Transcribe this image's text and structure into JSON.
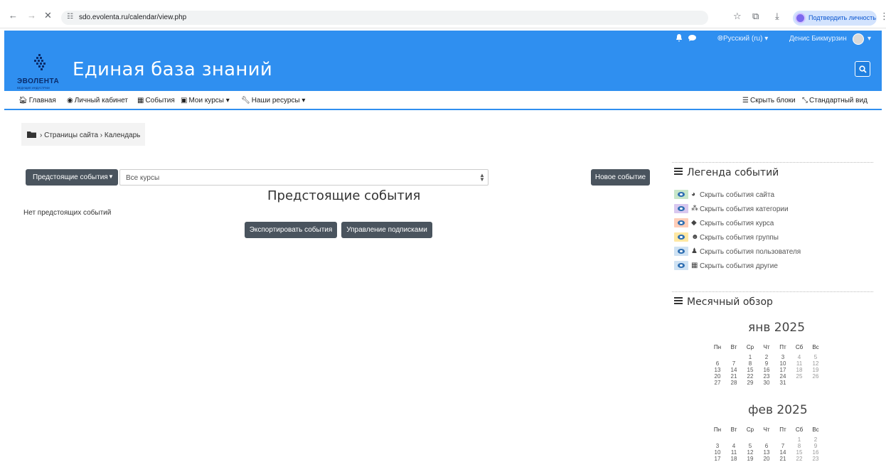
{
  "browser": {
    "url": "sdo.evolenta.ru/calendar/view.php",
    "verify_label": "Подтвердить личность"
  },
  "topbar": {
    "language": "Русский (ru) ▾",
    "user_name": "Денис Бикмурзин"
  },
  "header": {
    "logo_word": "ЭВОЛЕНТА",
    "logo_sub": "ВЕДУЩИЕ ИНДУСТРИИ",
    "site_title": "Единая база знаний"
  },
  "nav": {
    "items": [
      {
        "icon": "home-icon",
        "label": "Главная"
      },
      {
        "icon": "dashboard-icon",
        "label": "Личный кабинет"
      },
      {
        "icon": "calendar-icon",
        "label": "События"
      },
      {
        "icon": "briefcase-icon",
        "label": "Мои курсы ▾"
      },
      {
        "icon": "wrench-icon",
        "label": "Наши ресурсы ▾"
      }
    ],
    "hide_blocks": "Скрыть блоки",
    "standard_view": "Стандартный вид"
  },
  "breadcrumb": "› Страницы сайта › Календарь",
  "controls": {
    "view_button": "Предстоящие события",
    "course_select": "Все курсы",
    "new_event": "Новое событие"
  },
  "main": {
    "title": "Предстоящие события",
    "empty": "Нет предстоящих событий",
    "export_button": "Экспортировать события",
    "manage_button": "Управление подписками"
  },
  "legend": {
    "title": "Легенда событий",
    "items": [
      {
        "label": "Скрыть события сайта",
        "color": "#c8e6c9",
        "icon": "globe-icon"
      },
      {
        "label": "Скрыть события категории",
        "color": "#d9c8ef",
        "icon": "cubes-icon"
      },
      {
        "label": "Скрыть события курса",
        "color": "#ffcdb8",
        "icon": "graduation-cap-icon"
      },
      {
        "label": "Скрыть события группы",
        "color": "#ffe8a3",
        "icon": "users-icon"
      },
      {
        "label": "Скрыть события пользователя",
        "color": "#cfe2f3",
        "icon": "user-icon"
      },
      {
        "label": "Скрыть события другие",
        "color": "#cfe2f3",
        "icon": "calendar-icon"
      }
    ]
  },
  "monthly": {
    "title": "Месячный обзор",
    "weekdays": [
      "Пн",
      "Вт",
      "Ср",
      "Чт",
      "Пт",
      "Сб",
      "Вс"
    ],
    "months": [
      {
        "name": "янв 2025",
        "first_weekday": 2,
        "days": 31
      },
      {
        "name": "фев 2025",
        "first_weekday": 5,
        "days": 23
      }
    ]
  }
}
